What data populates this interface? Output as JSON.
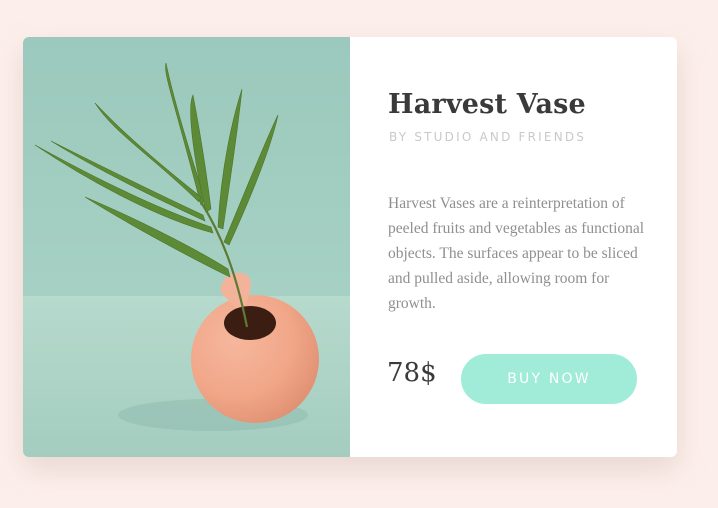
{
  "product": {
    "title": "Harvest Vase",
    "subtitle": "BY STUDIO AND FRIENDS",
    "description": "Harvest Vases are a reinterpretation of peeled fruits and vegetables as functional objects. The surfaces appear to be sliced and pulled aside, allowing room for growth.",
    "price": "78$",
    "buy_label": "BUY NOW",
    "image_icon": "vase-with-palm-leaf-photo"
  },
  "colors": {
    "page_background": "#fcefeb",
    "button_background": "#a0ecd8",
    "title_text": "#3a3a3a",
    "body_text": "#8f8f8f"
  }
}
